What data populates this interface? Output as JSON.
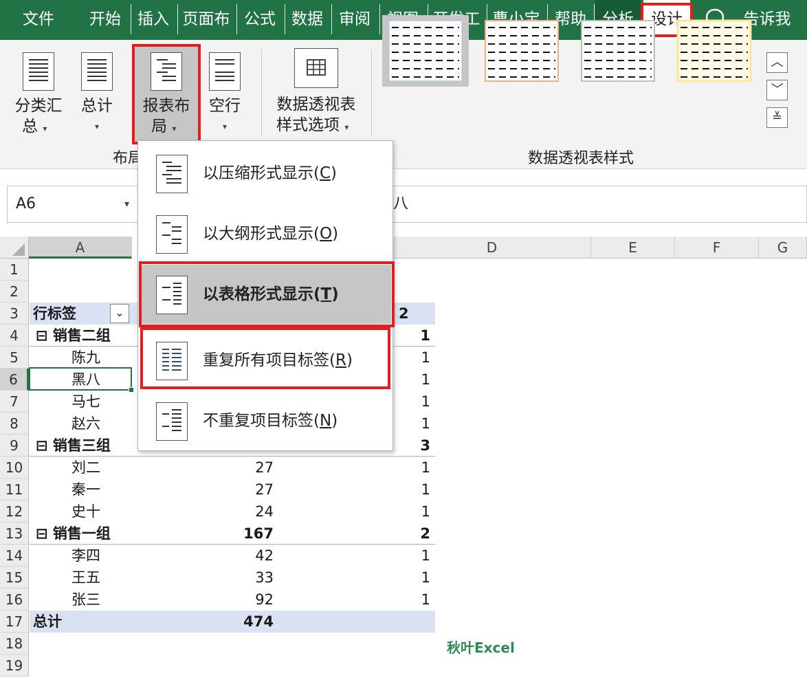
{
  "ribbon_tabs": [
    "文件",
    "开始",
    "插入",
    "页面布",
    "公式",
    "数据",
    "审阅",
    "视图",
    "开发工",
    "曹小宝",
    "帮助",
    "分析",
    "设计",
    "告诉我"
  ],
  "active_tab": "设计",
  "icons": {
    "tell_me": "lightbulb-icon"
  },
  "ribbon": {
    "subtotal": {
      "line1": "分类汇",
      "line2": "总",
      "caret": "▾"
    },
    "grand_total": {
      "line1": "总计",
      "caret": "▾"
    },
    "report_layout": {
      "line1": "报表布",
      "line2": "局",
      "caret": "▾"
    },
    "blank_rows": {
      "line1": "空行",
      "caret": "▾"
    },
    "style_options": {
      "line1": "数据透视表",
      "line2": "样式选项",
      "caret": "▾"
    },
    "group_layout": "布局",
    "group_styles": "数据透视表样式",
    "style_colors": [
      "#9dc3e6",
      "#f4b183",
      "#bfbfbf",
      "#ffe699"
    ]
  },
  "namebox": {
    "value": "A6",
    "caret": "▾"
  },
  "formula_value": "八",
  "columns": [
    "A",
    "D",
    "E",
    "F",
    "G"
  ],
  "rows": [
    "1",
    "2",
    "3",
    "4",
    "5",
    "6",
    "7",
    "8",
    "9",
    "10",
    "11",
    "12",
    "13",
    "14",
    "15",
    "16",
    "17",
    "18",
    "19"
  ],
  "pivot": {
    "header": {
      "row_label": "行标签",
      "filter": "⌄",
      "col2": "2"
    },
    "rows": [
      {
        "label": "⊟ 销售二组",
        "bold": true,
        "b": "",
        "c": "1"
      },
      {
        "label": "陈九",
        "bold": false,
        "b": "",
        "c": "1"
      },
      {
        "label": "黑八",
        "bold": false,
        "b": "",
        "c": "1"
      },
      {
        "label": "马七",
        "bold": false,
        "b": "",
        "c": "1"
      },
      {
        "label": "赵六",
        "bold": false,
        "b": "",
        "c": "1"
      },
      {
        "label": "⊟ 销售三组",
        "bold": true,
        "b": "",
        "c": "3"
      },
      {
        "label": "刘二",
        "bold": false,
        "b": "27",
        "c": "1"
      },
      {
        "label": "秦一",
        "bold": false,
        "b": "27",
        "c": "1"
      },
      {
        "label": "史十",
        "bold": false,
        "b": "24",
        "c": "1"
      },
      {
        "label": "⊟ 销售一组",
        "bold": true,
        "b": "167",
        "c": "2"
      },
      {
        "label": "李四",
        "bold": false,
        "b": "42",
        "c": "1"
      },
      {
        "label": "王五",
        "bold": false,
        "b": "33",
        "c": "1"
      },
      {
        "label": "张三",
        "bold": false,
        "b": "92",
        "c": "1"
      }
    ],
    "total": {
      "label": "总计",
      "b": "474"
    }
  },
  "menu": [
    {
      "text": "以压缩形式显示(",
      "key": "C"
    },
    {
      "text": "以大纲形式显示(",
      "key": "O"
    },
    {
      "text": "以表格形式显示(",
      "key": "T"
    },
    {
      "text": "重复所有项目标签(",
      "key": "R"
    },
    {
      "text": "不重复项目标签(",
      "key": "N"
    }
  ],
  "menu_close": ")",
  "watermark": "秋叶Excel"
}
